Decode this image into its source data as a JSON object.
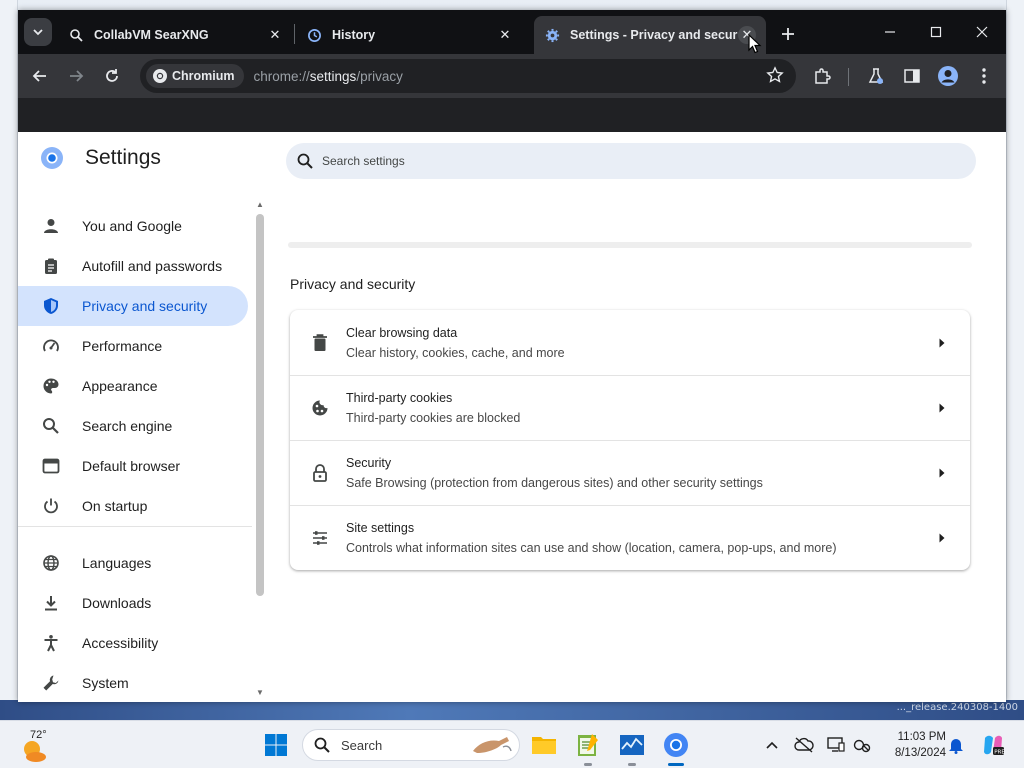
{
  "tabs": [
    {
      "title": "CollabVM SearXNG",
      "icon": "searxng-icon",
      "active": false
    },
    {
      "title": "History",
      "icon": "history-icon",
      "active": false
    },
    {
      "title": "Settings - Privacy and security",
      "icon": "settings-gear-icon",
      "active": true
    }
  ],
  "omnibox": {
    "chip_label": "Chromium",
    "url_prefix": "chrome://",
    "url_host": "settings",
    "url_path": "/privacy"
  },
  "settings": {
    "title": "Settings",
    "search_placeholder": "Search settings",
    "nav": [
      {
        "label": "You and Google",
        "icon": "person-icon",
        "selected": false
      },
      {
        "label": "Autofill and passwords",
        "icon": "clipboard-icon",
        "selected": false
      },
      {
        "label": "Privacy and security",
        "icon": "shield-icon",
        "selected": true
      },
      {
        "label": "Performance",
        "icon": "speedometer-icon",
        "selected": false
      },
      {
        "label": "Appearance",
        "icon": "palette-icon",
        "selected": false
      },
      {
        "label": "Search engine",
        "icon": "search-icon",
        "selected": false
      },
      {
        "label": "Default browser",
        "icon": "browser-window-icon",
        "selected": false
      },
      {
        "label": "On startup",
        "icon": "power-icon",
        "selected": false
      },
      {
        "label": "Languages",
        "icon": "globe-icon",
        "selected": false
      },
      {
        "label": "Downloads",
        "icon": "download-icon",
        "selected": false
      },
      {
        "label": "Accessibility",
        "icon": "accessibility-icon",
        "selected": false
      },
      {
        "label": "System",
        "icon": "wrench-icon",
        "selected": false
      }
    ],
    "section_title": "Privacy and security",
    "rows": [
      {
        "title": "Clear browsing data",
        "subtitle": "Clear history, cookies, cache, and more",
        "icon": "trash-icon"
      },
      {
        "title": "Third-party cookies",
        "subtitle": "Third-party cookies are blocked",
        "icon": "cookie-icon"
      },
      {
        "title": "Security",
        "subtitle": "Safe Browsing (protection from dangerous sites) and other security settings",
        "icon": "lock-icon"
      },
      {
        "title": "Site settings",
        "subtitle": "Controls what information sites can use and show (location, camera, pop-ups, and more)",
        "icon": "sliders-icon"
      }
    ]
  },
  "taskbar": {
    "temperature": "72°",
    "search_label": "Search",
    "time": "11:03 PM",
    "date": "8/13/2024"
  },
  "desktop": {
    "release_text": "..._release.240308-1400"
  },
  "colors": {
    "accent": "#0b57d0",
    "nav_selected_bg": "#d3e3fd",
    "tabstrip_bg": "#101114",
    "toolbar_bg": "#35363a"
  }
}
